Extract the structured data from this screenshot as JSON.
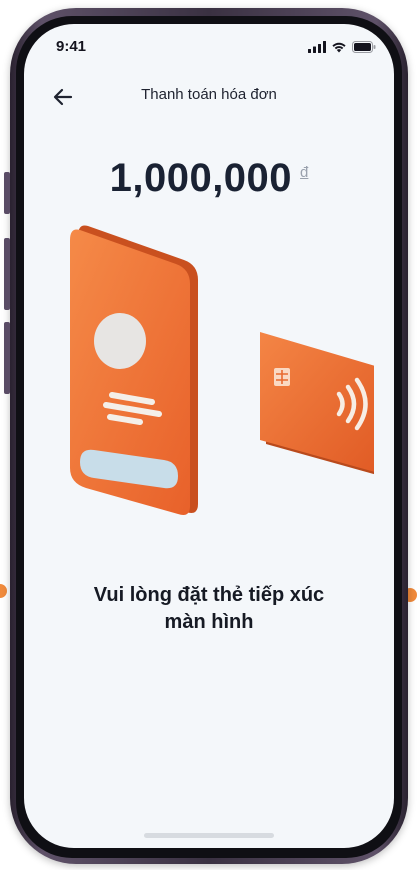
{
  "status_bar": {
    "time": "9:41",
    "icons": [
      "signal-icon",
      "wifi-icon",
      "battery-icon"
    ]
  },
  "header": {
    "back_icon": "arrow-left-icon",
    "title": "Thanh toán hóa đơn"
  },
  "payment": {
    "amount": "1,000,000",
    "currency": "đ"
  },
  "illustration": {
    "phone_icon": "phone-illustration",
    "card_icon": "contactless-card-illustration",
    "accent_color": "#f07a35"
  },
  "instruction": {
    "line1": "Vui lòng đặt thẻ tiếp xúc",
    "line2": "màn hình"
  },
  "colors": {
    "screen_background": "#f4f7fa",
    "accent": "#f07a35",
    "frame": "#3a3142"
  }
}
